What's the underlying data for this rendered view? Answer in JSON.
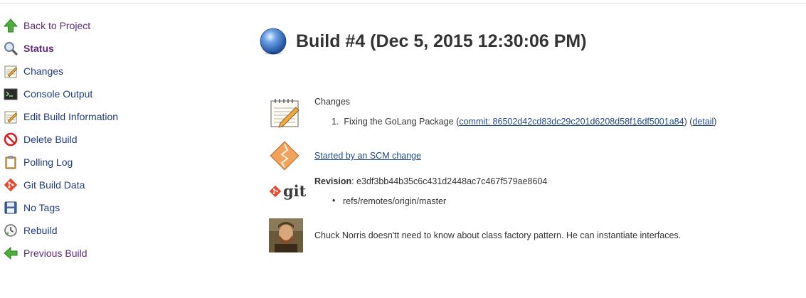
{
  "sidebar": {
    "items": [
      {
        "label": "Back to Project",
        "icon": "up-arrow-icon"
      },
      {
        "label": "Status",
        "icon": "magnifier-icon"
      },
      {
        "label": "Changes",
        "icon": "notepad-icon"
      },
      {
        "label": "Console Output",
        "icon": "terminal-icon"
      },
      {
        "label": "Edit Build Information",
        "icon": "notepad-edit-icon"
      },
      {
        "label": "Delete Build",
        "icon": "no-entry-icon"
      },
      {
        "label": "Polling Log",
        "icon": "clipboard-icon"
      },
      {
        "label": "Git Build Data",
        "icon": "git-icon"
      },
      {
        "label": "No Tags",
        "icon": "floppy-disk-icon"
      },
      {
        "label": "Rebuild",
        "icon": "rebuild-clock-icon"
      },
      {
        "label": "Previous Build",
        "icon": "left-arrow-icon"
      }
    ]
  },
  "build": {
    "title": "Build #4 (Dec 5, 2015 12:30:06 PM)",
    "status_color": "#3f77c9"
  },
  "changes": {
    "heading": "Changes",
    "item_number": "1.",
    "message": "Fixing the GoLang Package",
    "commit_prefix": "(",
    "commit_link": "commit: 86502d42cd83dc29c201d6208d58f16df5001a84",
    "commit_suffix": ")",
    "detail_prefix": "(",
    "detail_link": "detail",
    "detail_suffix": ")"
  },
  "cause": {
    "link": "Started by an SCM change"
  },
  "git": {
    "revision_label": "Revision",
    "revision_value": ": e3df3bb44b35c6c431d2448ac7c467f579ae8604",
    "branch": "refs/remotes/origin/master",
    "logo_text": "git"
  },
  "chuck": {
    "quote": "Chuck Norris doesn'tt need to know about class factory pattern. He can instantiate interfaces."
  }
}
